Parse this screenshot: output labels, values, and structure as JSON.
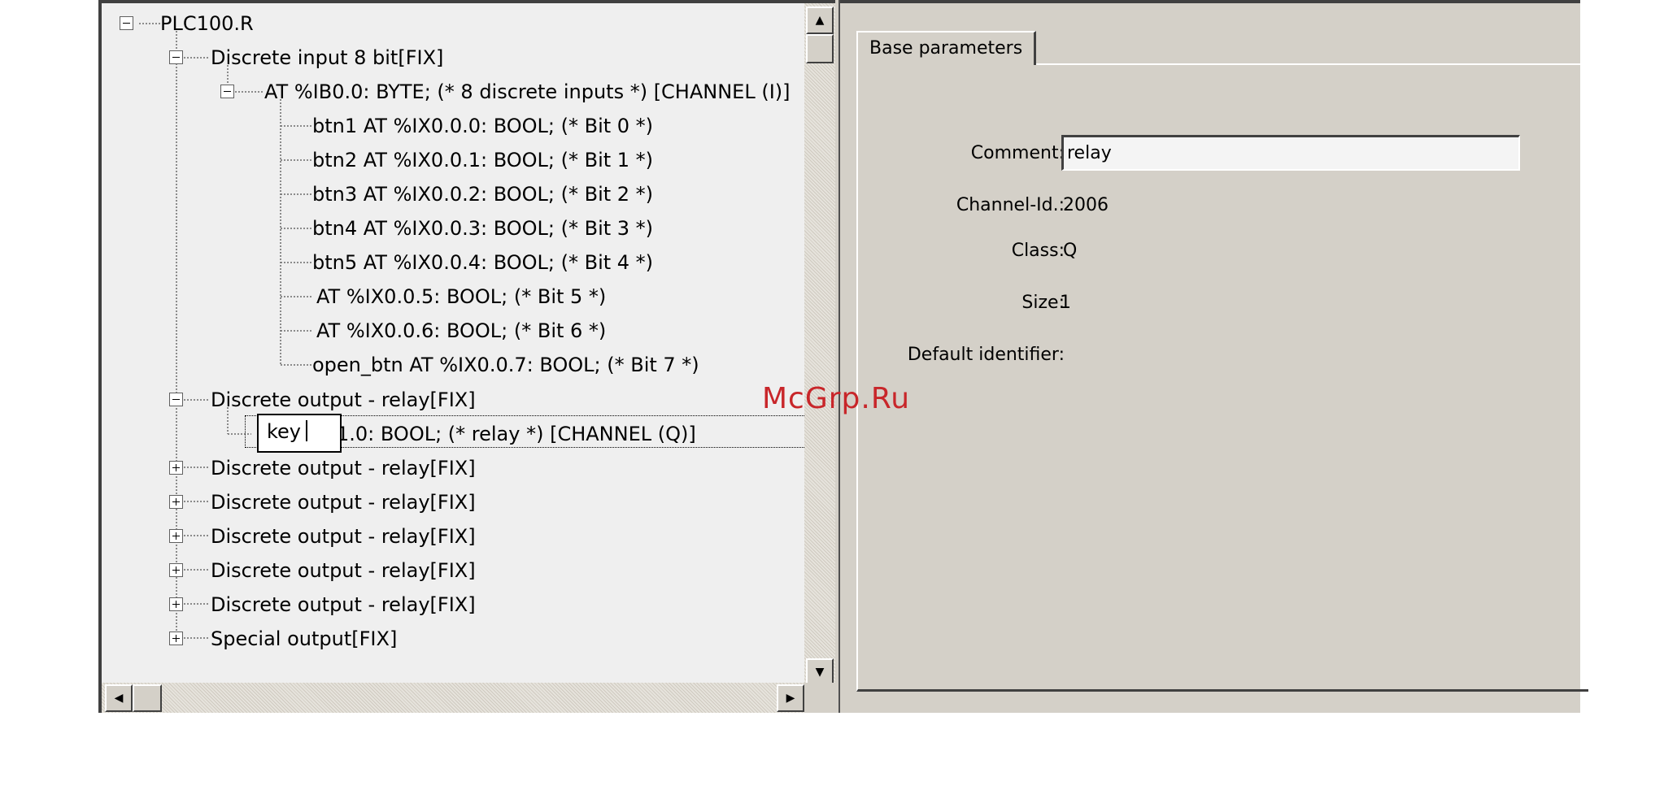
{
  "tree": {
    "nodes": [
      {
        "id": "root",
        "label": "PLC100.R",
        "state": "expanded"
      },
      {
        "id": "discrete-input",
        "label": "Discrete input 8 bit[FIX]",
        "state": "expanded"
      },
      {
        "id": "byte-channel",
        "label": "AT %IB0.0: BYTE; (* 8 discrete inputs *) [CHANNEL (I)]",
        "state": "expanded"
      },
      {
        "id": "btn1",
        "label": "btn1 AT %IX0.0.0: BOOL; (* Bit 0 *)"
      },
      {
        "id": "btn2",
        "label": "btn2 AT %IX0.0.1: BOOL; (* Bit 1 *)"
      },
      {
        "id": "btn3",
        "label": "btn3 AT %IX0.0.2: BOOL; (* Bit 2 *)"
      },
      {
        "id": "btn4",
        "label": "btn4 AT %IX0.0.3: BOOL; (* Bit 3 *)"
      },
      {
        "id": "btn5",
        "label": "btn5 AT %IX0.0.4: BOOL; (* Bit 4 *)"
      },
      {
        "id": "bit5",
        "label": "AT %IX0.0.5: BOOL; (* Bit 5 *)"
      },
      {
        "id": "bit6",
        "label": "AT %IX0.0.6: BOOL; (* Bit 6 *)"
      },
      {
        "id": "open-btn",
        "label": "open_btn AT %IX0.0.7: BOOL; (* Bit 7 *)"
      },
      {
        "id": "relay-1",
        "label": "Discrete output - relay[FIX]",
        "state": "expanded"
      },
      {
        "id": "relay-channel",
        "label": "1.0: BOOL; (* relay *) [CHANNEL (Q)]",
        "editing": true
      },
      {
        "id": "relay-2",
        "label": "Discrete output - relay[FIX]",
        "state": "collapsed"
      },
      {
        "id": "relay-3",
        "label": "Discrete output - relay[FIX]",
        "state": "collapsed"
      },
      {
        "id": "relay-4",
        "label": "Discrete output - relay[FIX]",
        "state": "collapsed"
      },
      {
        "id": "relay-5",
        "label": "Discrete output - relay[FIX]",
        "state": "collapsed"
      },
      {
        "id": "relay-6",
        "label": "Discrete output - relay[FIX]",
        "state": "collapsed"
      },
      {
        "id": "special-output",
        "label": "Special output[FIX]",
        "state": "collapsed"
      }
    ],
    "rename_value": "key",
    "vertical_scroll": {
      "up_icon": "arrow-up-icon",
      "down_icon": "arrow-down-icon"
    },
    "horizontal_scroll": {
      "left_icon": "arrow-left-icon",
      "right_icon": "arrow-right-icon"
    }
  },
  "details": {
    "tab_label": "Base parameters",
    "fields": {
      "comment_label": "Comment:",
      "comment_value": "relay",
      "channel_id_label": "Channel-Id.:",
      "channel_id_value": "2006",
      "class_label": "Class:",
      "class_value": "Q",
      "size_label": "Size:",
      "size_value": "1",
      "default_identifier_label": "Default identifier:"
    }
  },
  "watermark": "McGrp.Ru",
  "colors": {
    "tree_bg": "#efefef",
    "window_bg": "#d4d0c8",
    "watermark": "#c8262a"
  }
}
